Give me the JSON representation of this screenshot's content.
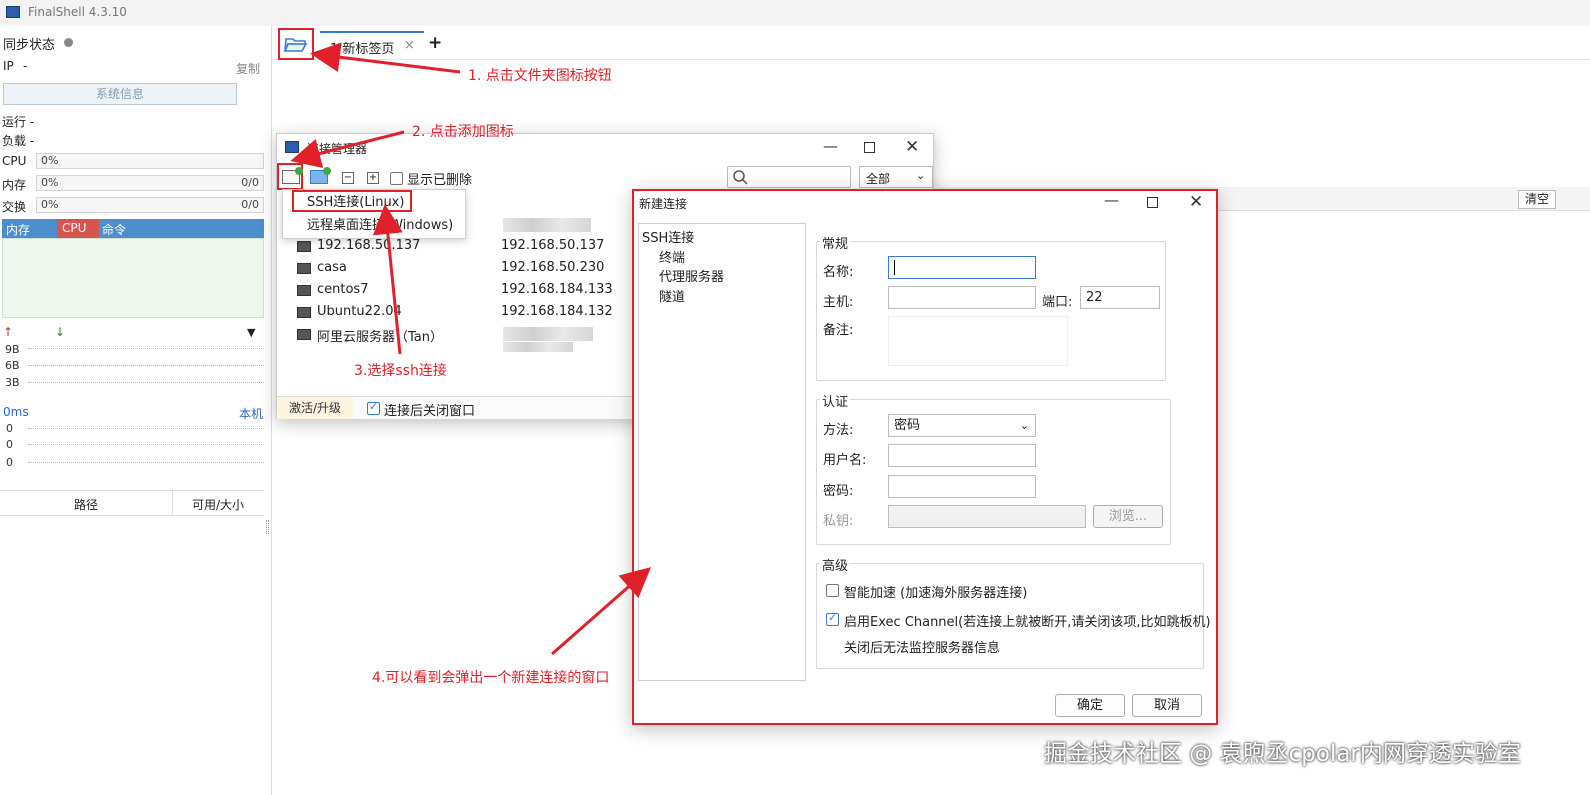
{
  "app": {
    "title": "FinalShell 4.3.10"
  },
  "left": {
    "sync_label": "同步状态",
    "ip_label": "IP",
    "ip_value": "-",
    "copy_label": "复制",
    "sysinfo_label": "系统信息",
    "run_label": "运行 -",
    "load_label": "负载 -",
    "cpu_label": "CPU",
    "cpu_value": "0%",
    "mem_label": "内存",
    "mem_value": "0%",
    "mem_ratio": "0/0",
    "swap_label": "交换",
    "swap_value": "0%",
    "swap_ratio": "0/0",
    "proc_cols": [
      "内存",
      "CPU",
      "命令"
    ],
    "net_ticks": [
      "9B",
      "6B",
      "3B"
    ],
    "latency_label": "0ms",
    "local_label": "本机",
    "latency_ticks": [
      "0",
      "0",
      "0"
    ],
    "path_col": "路径",
    "size_col": "可用/大小"
  },
  "tabs": {
    "active_label": "1 新标签页",
    "close_glyph": "×",
    "add_glyph": "+"
  },
  "conn_manager": {
    "title": "连接管理器",
    "show_deleted_label": "显示已删除",
    "filter_value": "全部",
    "rows": [
      {
        "name": "192.168.50.137",
        "host": "192.168.50.137"
      },
      {
        "name": "casa",
        "host": "192.168.50.230"
      },
      {
        "name": "centos7",
        "host": "192.168.184.133"
      },
      {
        "name": "Ubuntu22.04",
        "host": "192.168.184.132"
      },
      {
        "name": "阿里云服务器（Tan）",
        "host": ""
      }
    ],
    "activate_label": "激活/升级",
    "close_after_label": "连接后关闭窗口"
  },
  "menu": {
    "ssh_label": "SSH连接(Linux)",
    "rdp_label": "远程桌面连接(Windows)"
  },
  "new_conn": {
    "title": "新建连接",
    "tree": [
      "SSH连接",
      "终端",
      "代理服务器",
      "隧道"
    ],
    "general_title": "常规",
    "name_label": "名称:",
    "host_label": "主机:",
    "port_label": "端口:",
    "port_value": "22",
    "note_label": "备注:",
    "auth_title": "认证",
    "method_label": "方法:",
    "method_value": "密码",
    "user_label": "用户名:",
    "pass_label": "密码:",
    "key_label": "私钥:",
    "browse_label": "浏览...",
    "adv_title": "高级",
    "smart_label": "智能加速 (加速海外服务器连接)",
    "exec_label": "启用Exec Channel(若连接上就被断开,请关闭该项,比如跳板机)",
    "exec_note": "关闭后无法监控服务器信息",
    "ok_label": "确定",
    "cancel_label": "取消"
  },
  "right": {
    "clear_label": "清空"
  },
  "annotations": {
    "step1": "1. 点击文件夹图标按钮",
    "step2": "2. 点击添加图标",
    "step3": "3.选择ssh连接",
    "step4": "4.可以看到会弹出一个新建连接的窗口"
  },
  "watermark": "掘金技术社区 @ 袁煦丞cpolar内网穿透实验室",
  "colors": {
    "accent": "#3a7bd5",
    "annotation": "#e0202a",
    "cpu_col": "#d9534f",
    "proc_header": "#4d8ecf"
  }
}
